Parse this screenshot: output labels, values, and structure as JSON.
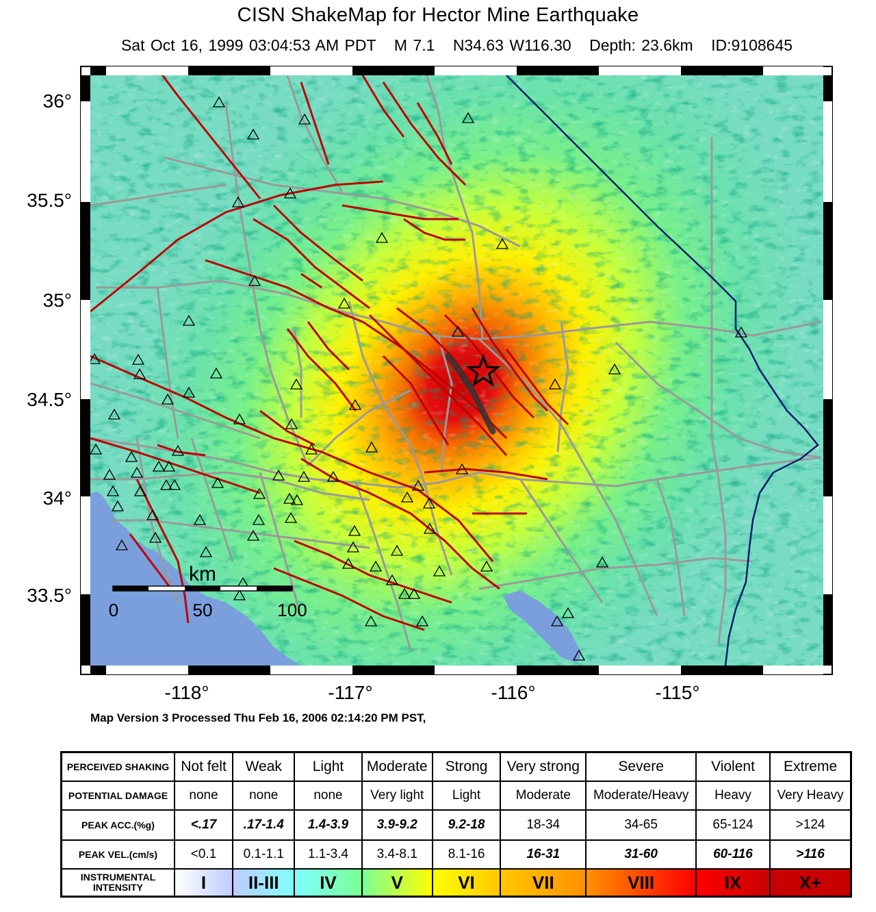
{
  "header": {
    "title": "CISN ShakeMap for Hector Mine Earthquake",
    "date": "Sat Oct 16, 1999 03:04:53 AM PDT",
    "magnitude": "M 7.1",
    "location": "N34.63 W116.30",
    "depth": "Depth: 23.6km",
    "event_id": "ID:9108645"
  },
  "map": {
    "lat_labels": [
      "36°",
      "35.5°",
      "35°",
      "34.5°",
      "34°",
      "33.5°"
    ],
    "lon_labels": [
      "-118°",
      "-117°",
      "-116°",
      "-115°"
    ],
    "scale_bar": {
      "unit": "km",
      "ticks": [
        "0",
        "50",
        "100"
      ]
    },
    "epicenter": {
      "lat": 34.63,
      "lon": -116.3,
      "symbol": "star-icon"
    },
    "colors": {
      "water": "#7a9fdc",
      "fault": "#c00000",
      "road": "#9a9a9a",
      "border": "#0a1b6e"
    }
  },
  "version_line": "Map Version 3 Processed Thu Feb 16, 2006 02:14:20 PM PST,",
  "legend": {
    "row_headers": {
      "shaking": "PERCEIVED SHAKING",
      "damage": "POTENTIAL DAMAGE",
      "acc": "PEAK ACC.(%g)",
      "vel": "PEAK VEL.(cm/s)",
      "intensity": "INSTRUMENTAL INTENSITY"
    },
    "shaking": [
      "Not felt",
      "Weak",
      "Light",
      "Moderate",
      "Strong",
      "Very strong",
      "Severe",
      "Violent",
      "Extreme"
    ],
    "damage": [
      "none",
      "none",
      "none",
      "Very light",
      "Light",
      "Moderate",
      "Moderate/Heavy",
      "Heavy",
      "Very Heavy"
    ],
    "acc": [
      "<.17",
      ".17-1.4",
      "1.4-3.9",
      "3.9-9.2",
      "9.2-18",
      "18-34",
      "34-65",
      "65-124",
      ">124"
    ],
    "vel": [
      "<0.1",
      "0.1-1.1",
      "1.1-3.4",
      "3.4-8.1",
      "8.1-16",
      "16-31",
      "31-60",
      "60-116",
      ">116"
    ],
    "intensity": [
      "I",
      "II-III",
      "IV",
      "V",
      "VI",
      "VII",
      "VIII",
      "IX",
      "X+"
    ],
    "intensity_colors": [
      "#ffffff",
      "#bfccff",
      "#80ffff",
      "#7aff93",
      "#ffff00",
      "#ffc800",
      "#ff9100",
      "#ff0000",
      "#c80000"
    ]
  }
}
